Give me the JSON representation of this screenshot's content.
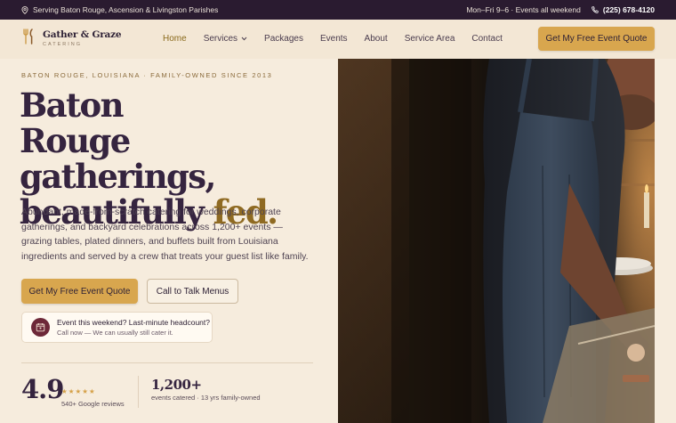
{
  "topbar": {
    "location": "Serving Baton Rouge, Ascension & Livingston Parishes",
    "hours": "Mon–Fri 9–6 · Events all weekend",
    "phone": "(225) 678-4120"
  },
  "brand": {
    "name": "Gather & Graze",
    "tagline": "CATERING"
  },
  "nav": {
    "items": [
      {
        "label": "Home",
        "active": true
      },
      {
        "label": "Services",
        "dropdown": true
      },
      {
        "label": "Packages"
      },
      {
        "label": "Events"
      },
      {
        "label": "About"
      },
      {
        "label": "Service Area"
      },
      {
        "label": "Contact"
      }
    ],
    "cta": "Get My Free Event Quote"
  },
  "hero": {
    "eyebrow": "BATON ROUGE, LOUISIANA · FAMILY-OWNED SINCE 2013",
    "headline_line1": "Baton",
    "headline_line2": "Rouge gatherings,",
    "headline_line3": "beautifully",
    "headline_accent": "fed.",
    "lede": "Abundant, made-from-scratch catering for weddings, corporate gatherings, and backyard celebrations across 1,200+ events — grazing tables, plated dinners, and buffets built from Louisiana ingredients and served by a crew that treats your guest list like family.",
    "primary_cta": "Get My Free Event Quote",
    "secondary_cta": "Call to Talk Menus",
    "notice_title": "Event this weekend? Last-minute headcount?",
    "notice_sub": "Call now — We can usually still cater it."
  },
  "stats": {
    "rating": "4.9",
    "rating_stars": 5,
    "reviews": "540+ Google reviews",
    "events": "1,200+",
    "events_sub": "events catered · 13 yrs family-owned"
  },
  "colors": {
    "accent": "#d8a64e",
    "dark": "#2a1b30",
    "headline": "#35243f",
    "headline_accent": "#8f6a22",
    "background": "#f6ecdd"
  },
  "icons": [
    "location-pin-icon",
    "phone-icon",
    "fork-knife-logo-icon",
    "chevron-down-icon",
    "calendar-icon",
    "star-icon"
  ]
}
